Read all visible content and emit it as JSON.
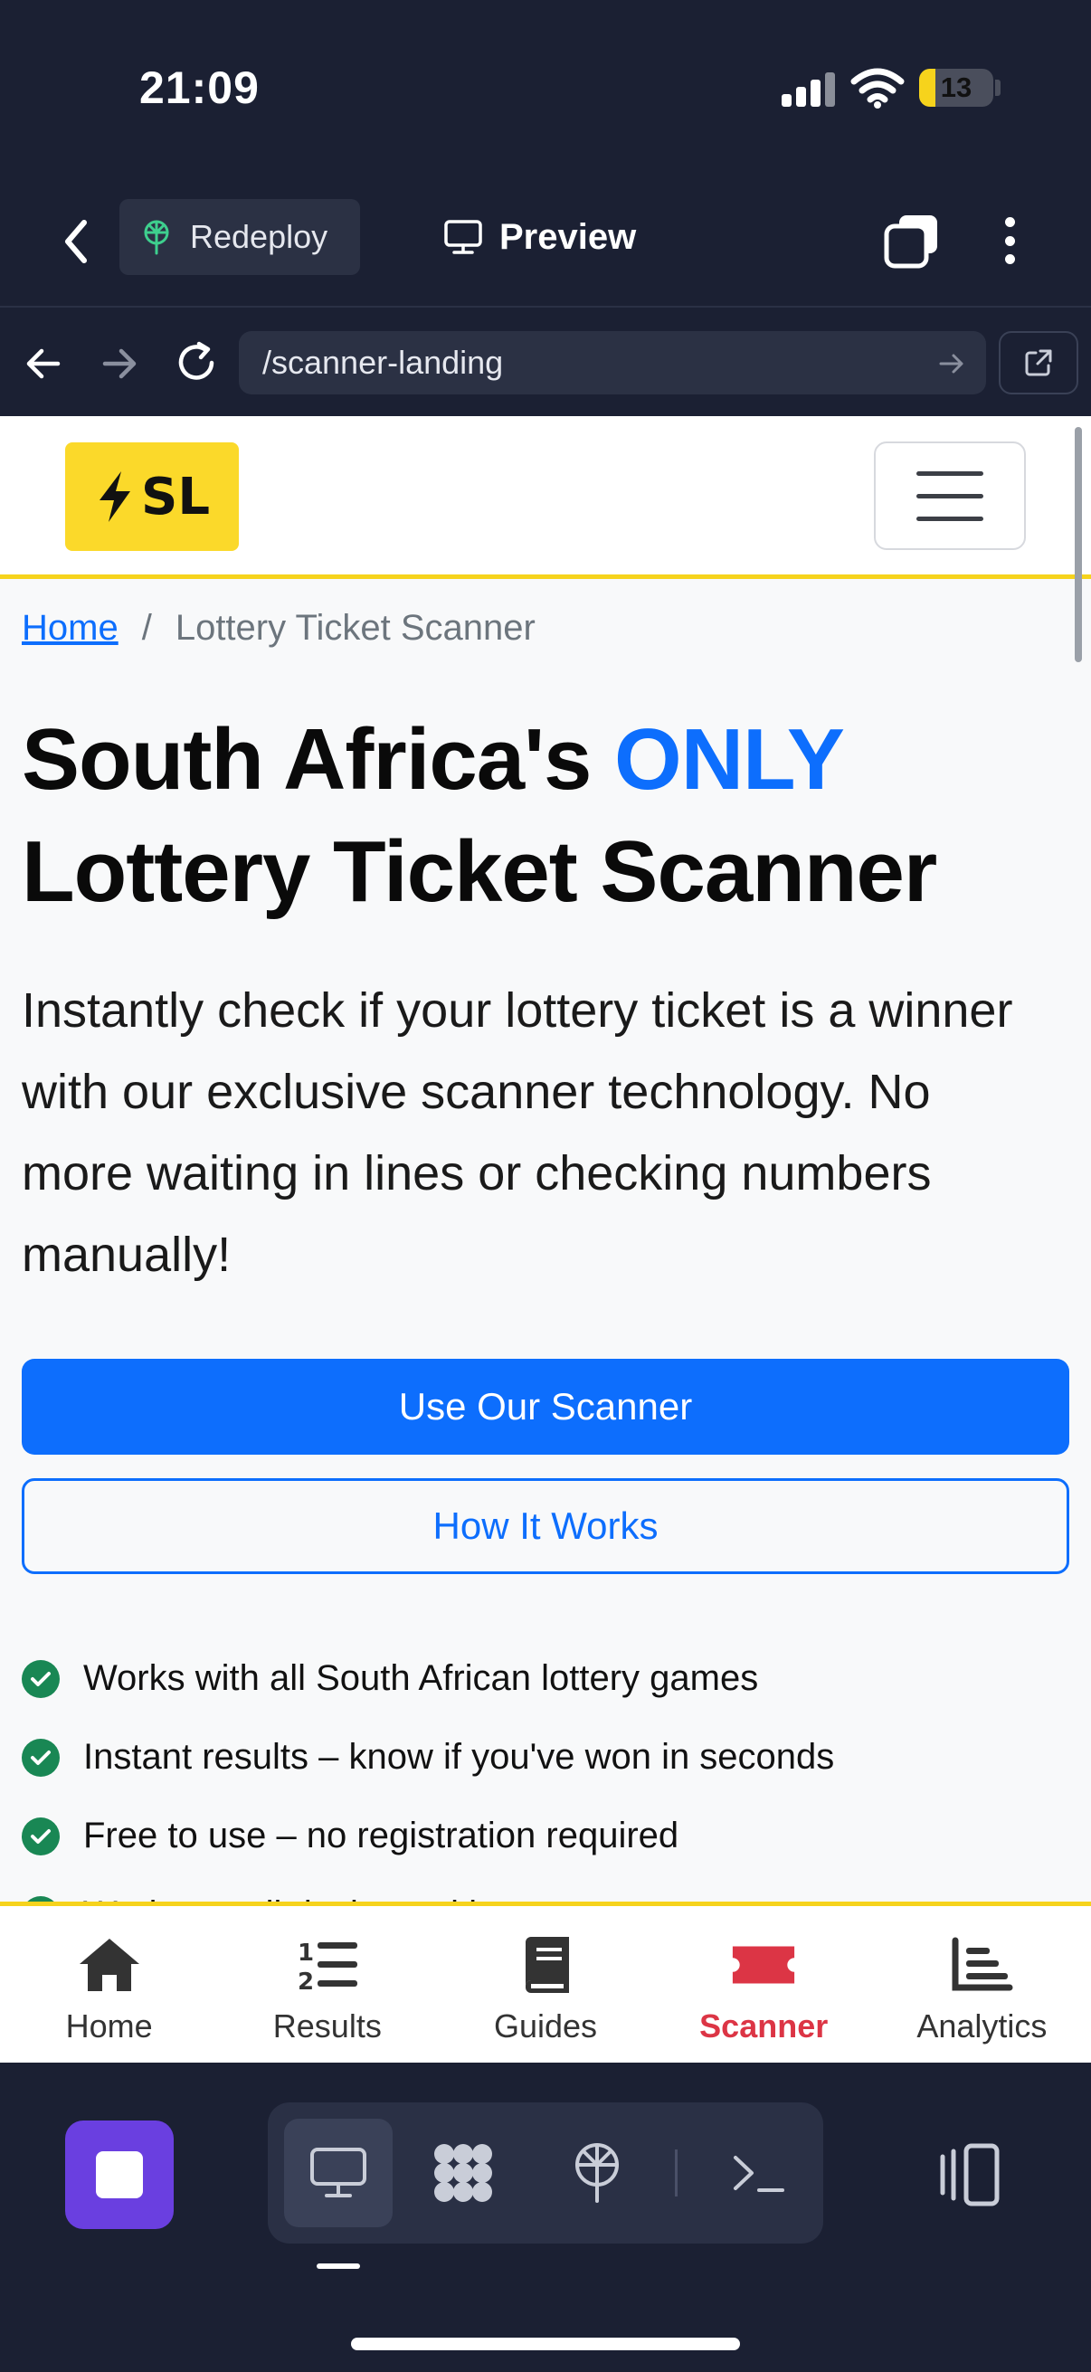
{
  "status_bar": {
    "time": "21:09",
    "battery": "13",
    "battery_level": 0.13
  },
  "toolbar": {
    "redeploy_label": "Redeploy",
    "preview_label": "Preview"
  },
  "url_bar": {
    "url": "/scanner-landing"
  },
  "site": {
    "logo_text": "SL",
    "breadcrumb": {
      "home": "Home",
      "separator": "/",
      "current": "Lottery Ticket Scanner"
    },
    "hero": {
      "title_part1": "South Africa's ",
      "title_accent": "ONLY",
      "title_part2": "Lottery Ticket Scanner",
      "lead": "Instantly check if your lottery ticket is a winner with our exclusive scanner technology. No more waiting in lines or checking numbers manually!"
    },
    "buttons": {
      "primary": "Use Our Scanner",
      "secondary": "How It Works"
    },
    "features": [
      "Works with all South African lottery games",
      "Instant results – know if you've won in seconds",
      "Free to use – no registration required",
      "Works on all devices with a camera"
    ]
  },
  "tab_nav": {
    "items": [
      {
        "label": "Home",
        "icon": "home-icon"
      },
      {
        "label": "Results",
        "icon": "list-ordered-icon"
      },
      {
        "label": "Guides",
        "icon": "book-icon"
      },
      {
        "label": "Scanner",
        "icon": "ticket-icon",
        "active": true
      },
      {
        "label": "Analytics",
        "icon": "chart-icon"
      }
    ]
  },
  "colors": {
    "primary": "#0d6efd",
    "accent_yellow": "#f6d31c",
    "active_tab": "#dc3545",
    "success": "#198754",
    "dark_chrome": "#1b2033",
    "stop_button": "#6a3fe0"
  }
}
